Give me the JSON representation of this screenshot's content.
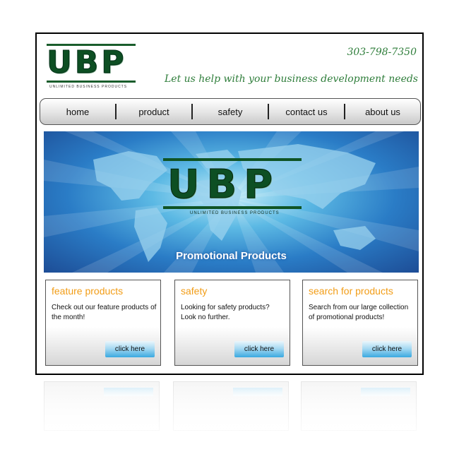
{
  "header": {
    "logo_text": "UBP",
    "logo_tagline": "UNLIMITED BUSINESS PRODUCTS",
    "phone": "303-798-7350",
    "tagline": "Let us help with your business development needs"
  },
  "nav": {
    "items": [
      {
        "label": "home"
      },
      {
        "label": "product"
      },
      {
        "label": "safety"
      },
      {
        "label": "contact us"
      },
      {
        "label": "about us"
      }
    ]
  },
  "banner": {
    "logo_text": "UBP",
    "logo_tagline": "UNLIMITED BUSINESS PRODUCTS",
    "caption": "Promotional Products"
  },
  "boxes": [
    {
      "title": "feature products",
      "description": "Check out our feature products of the month!",
      "button": "click here"
    },
    {
      "title": "safety",
      "description": "Looking for safety products? Look no further.",
      "button": "click here"
    },
    {
      "title": "search for products",
      "description": "Search from our large collection of promotional products!",
      "button": "click here"
    }
  ],
  "colors": {
    "brand_green": "#0d4f23",
    "accent_orange": "#f29d17",
    "button_blue": "#3aa9e0"
  }
}
